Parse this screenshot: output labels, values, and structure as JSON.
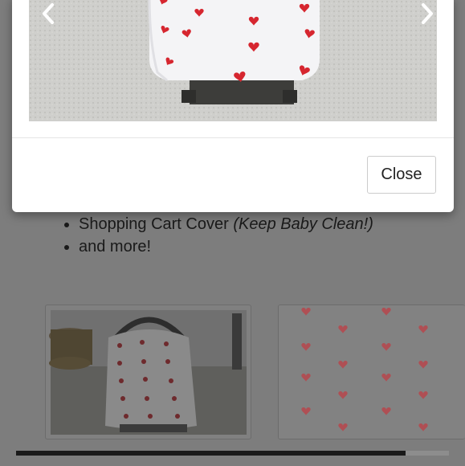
{
  "product": {
    "bullets": [
      {
        "text": "Shopping Cart Cover ",
        "emphasis": "(Keep Baby Clean!)"
      },
      {
        "text": "and more!",
        "emphasis": ""
      }
    ]
  },
  "gallery": {
    "thumbnails": [
      {
        "icon": "car-seat-cover-photo"
      },
      {
        "icon": "heart-pattern-swatch"
      }
    ],
    "scroll_progress": 0.9
  },
  "modal": {
    "image_icon": "car-seat-cover-photo",
    "prev_icon": "chevron-left-icon",
    "next_icon": "chevron-right-icon",
    "close_label": "Close"
  },
  "colors": {
    "heart": "#d6262f",
    "overlay": "#7b7b7b",
    "modal_bg": "#ffffff"
  }
}
